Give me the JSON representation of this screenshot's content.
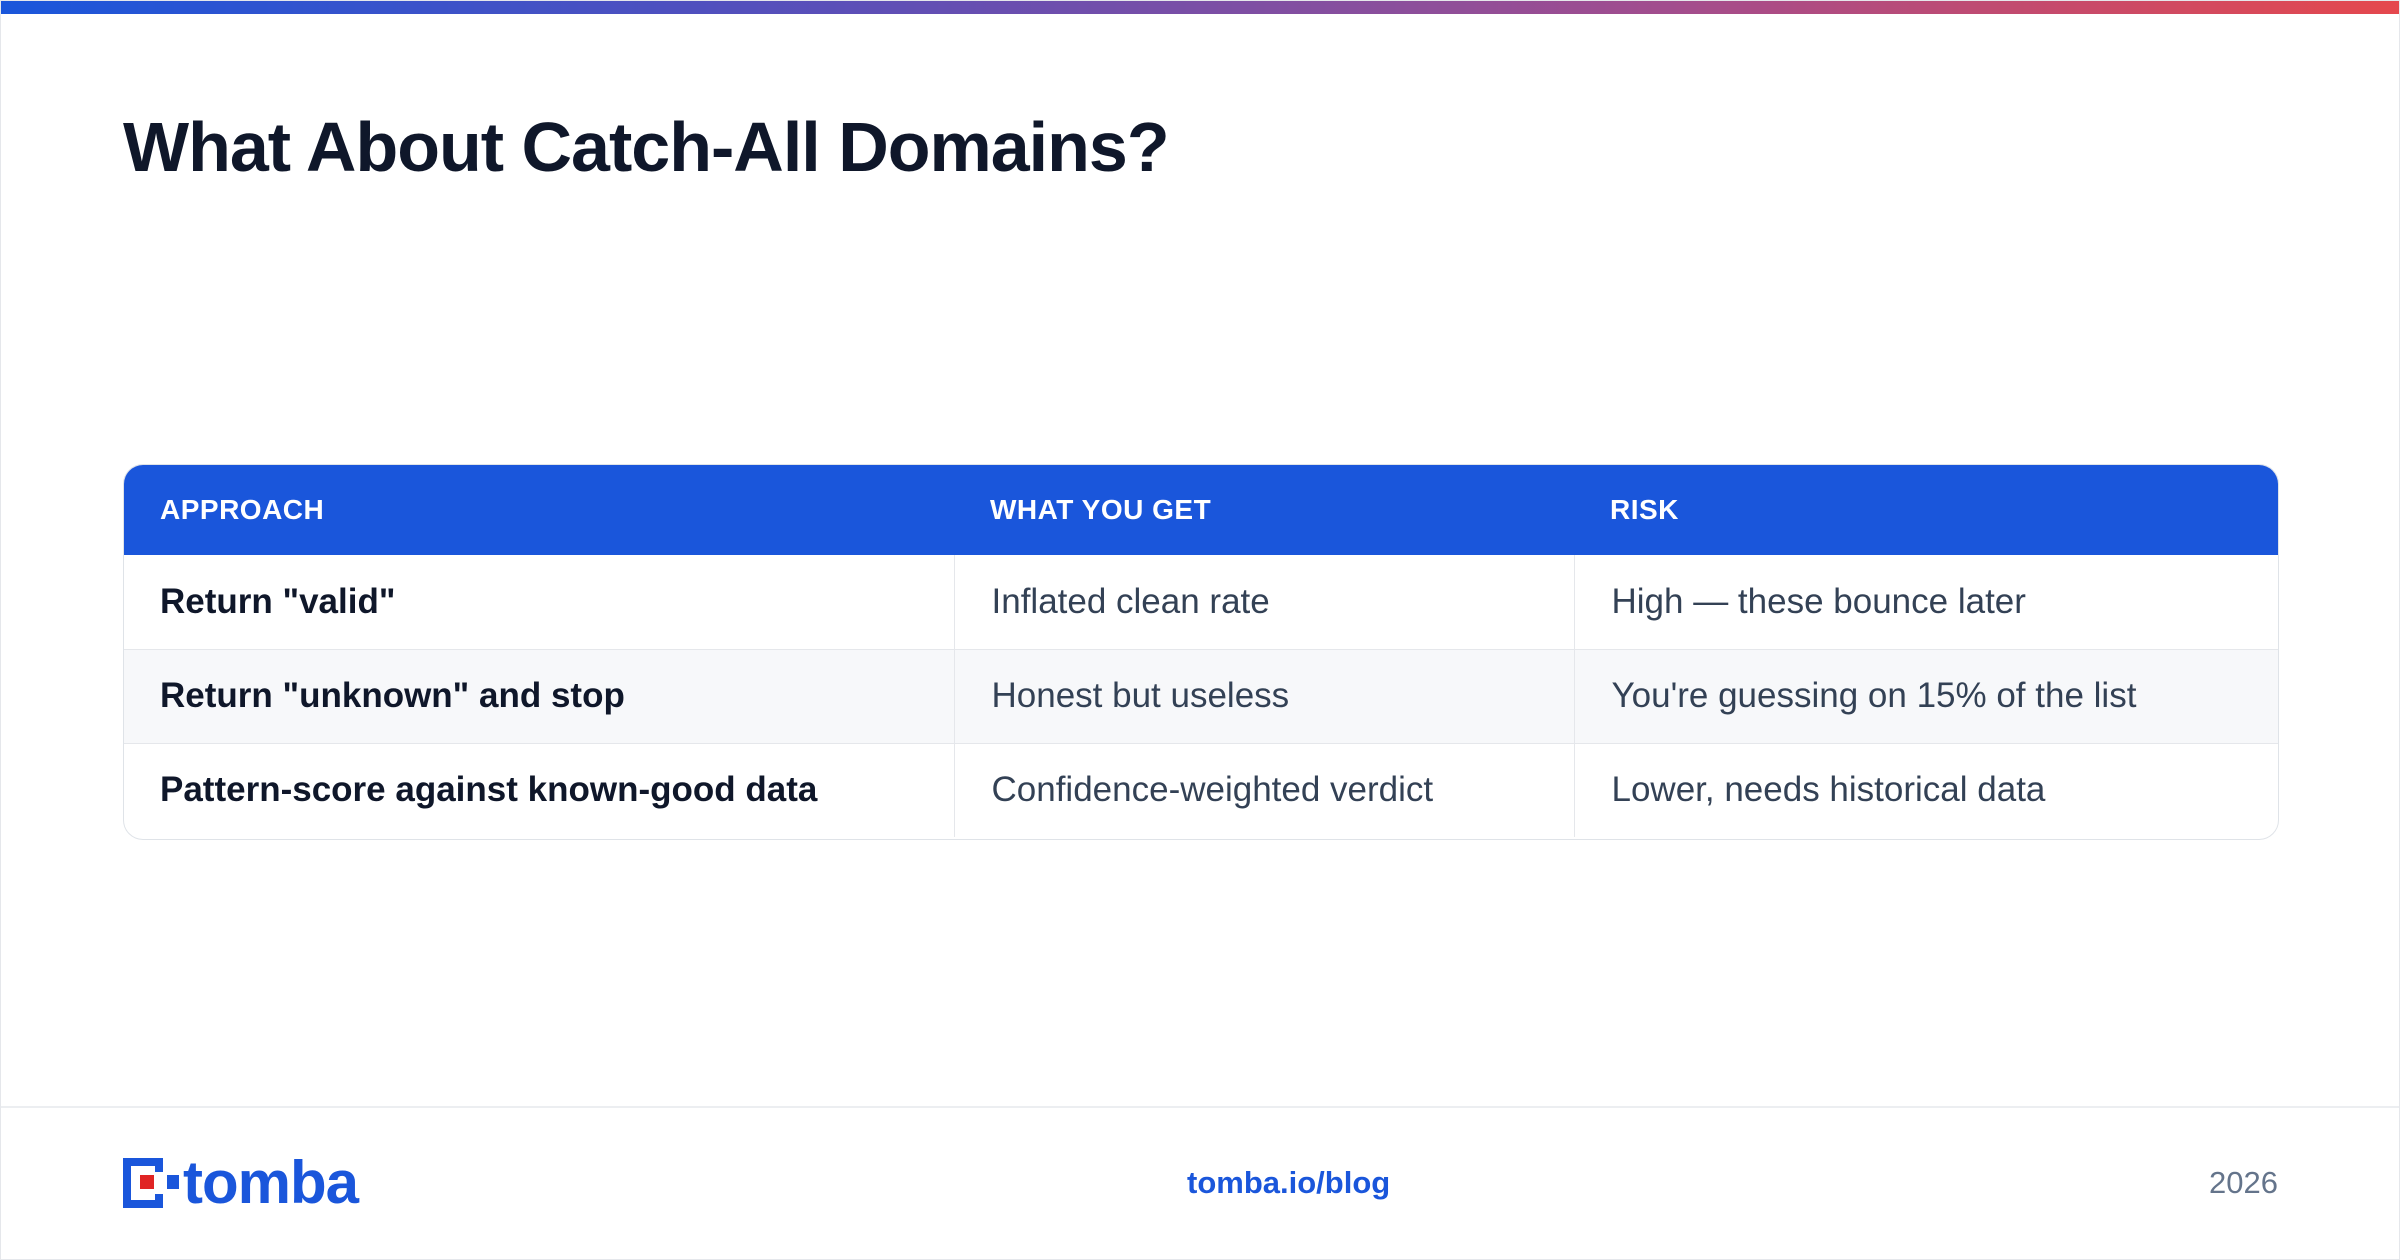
{
  "colors": {
    "accent": "#1a56db",
    "logo_red": "#e02424",
    "gradient_start": "#1a56db",
    "gradient_end": "#e5484d"
  },
  "header": {
    "title": "What About Catch-All Domains?"
  },
  "table": {
    "columns": [
      "APPROACH",
      "WHAT YOU GET",
      "RISK"
    ],
    "rows": [
      [
        "Return \"valid\"",
        "Inflated clean rate",
        "High — these bounce later"
      ],
      [
        "Return \"unknown\" and stop",
        "Honest but useless",
        "You're guessing on 15% of the list"
      ],
      [
        "Pattern-score against known-good data",
        "Confidence-weighted verdict",
        "Lower, needs historical data"
      ]
    ]
  },
  "footer": {
    "logo_text": "tomba",
    "logo_icon": "tomba-mark-icon",
    "link": "tomba.io/blog",
    "year": "2026"
  }
}
